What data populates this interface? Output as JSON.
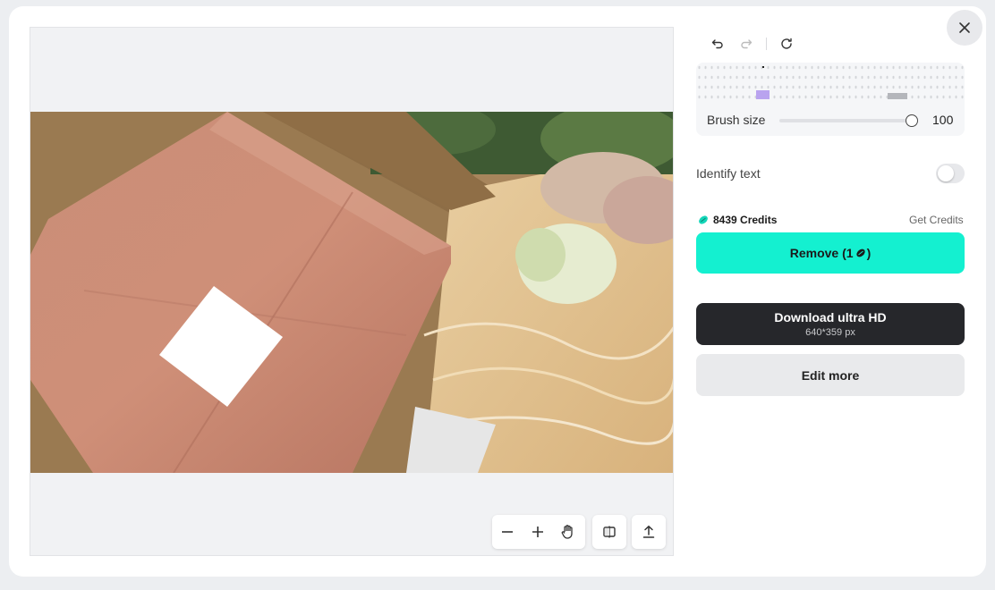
{
  "editor": {
    "brush_label": "Brush size",
    "brush_value": "100",
    "brush_level_percent": 100,
    "identify_text_label": "Identify text",
    "identify_text_on": false,
    "credits_text": "8439 Credits",
    "get_credits_label": "Get Credits",
    "remove_label": "Remove (1",
    "remove_suffix": ")",
    "download_label": "Download ultra HD",
    "download_size": "640*359 px",
    "edit_more_label": "Edit more"
  },
  "icons": {
    "close": "close-icon",
    "undo": "undo-icon",
    "redo": "redo-icon",
    "reset": "refresh-icon",
    "zoom_out": "minus-icon",
    "zoom_in": "plus-icon",
    "pan": "hand-icon",
    "compare": "compare-icon",
    "upload": "upload-icon",
    "credit": "bean-icon"
  },
  "colors": {
    "accent": "#14f0d0",
    "dark_button": "#26272b",
    "brush_marker": "#b9a3ef"
  }
}
